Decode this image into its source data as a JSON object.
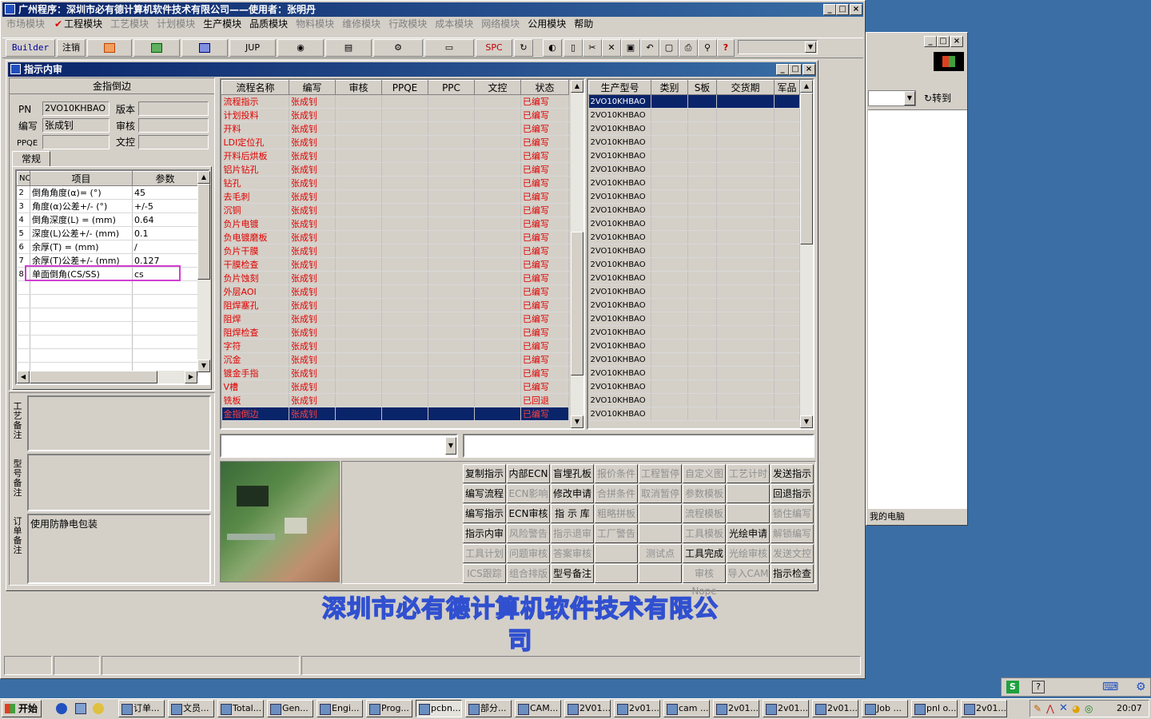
{
  "main_window": {
    "title": "广州程序：深圳市必有德计算机软件技术有限公司——使用者：张明丹"
  },
  "menu": [
    {
      "label": "市场模块",
      "active": false
    },
    {
      "label": "工程模块",
      "active": true,
      "check": "✔"
    },
    {
      "label": "工艺模块",
      "active": false
    },
    {
      "label": "计划模块",
      "active": false
    },
    {
      "label": "生产模块",
      "active": true
    },
    {
      "label": "品质模块",
      "active": true
    },
    {
      "label": "物料模块",
      "active": false
    },
    {
      "label": "维修模块",
      "active": false
    },
    {
      "label": "行政模块",
      "active": false
    },
    {
      "label": "成本模块",
      "active": false
    },
    {
      "label": "网络模块",
      "active": false
    },
    {
      "label": "公用模块",
      "active": true
    },
    {
      "label": "帮助",
      "active": true
    }
  ],
  "toolbar": {
    "builder": "Builder",
    "logout": "注销",
    "jup": "JUP",
    "spc": "SPC"
  },
  "child_window": {
    "title": "指示内审"
  },
  "left_panel": {
    "section_title": "金指倒边",
    "pn_label": "PN",
    "pn_value": "2VO10KHBAO",
    "version_label": "版本",
    "version_value": "",
    "author_label": "编写",
    "author_value": "张成钊",
    "review_label": "审核",
    "review_value": "",
    "ppqe_label": "PPQE",
    "ppqe_value": "",
    "doc_label": "文控",
    "doc_value": "",
    "tab": "常规",
    "param_headers": {
      "no": "NO",
      "item": "项目",
      "param": "参数"
    },
    "params": [
      {
        "no": "2",
        "item": "倒角角度(α)=  (°)",
        "value": "45"
      },
      {
        "no": "3",
        "item": "角度(α)公差+/-  (°)",
        "value": "+/-5"
      },
      {
        "no": "4",
        "item": "倒角深度(L) =  (mm)",
        "value": "0.64"
      },
      {
        "no": "5",
        "item": "深度(L)公差+/-  (mm)",
        "value": "0.1"
      },
      {
        "no": "6",
        "item": "余厚(T) =  (mm)",
        "value": "/"
      },
      {
        "no": "7",
        "item": "余厚(T)公差+/-  (mm)",
        "value": "0.127"
      },
      {
        "no": "8",
        "item": "单面倒角(CS/SS)",
        "value": "cs"
      }
    ],
    "notes": {
      "craft_label": "工艺备注",
      "model_label": "型号备注",
      "order_label": "订单备注",
      "craft": "",
      "model": "",
      "order": "使用防静电包装"
    }
  },
  "process_table": {
    "headers": [
      "流程名称",
      "编写",
      "审核",
      "PPQE",
      "PPC",
      "文控",
      "状态"
    ],
    "rows": [
      {
        "name": "流程指示",
        "author": "张成钊",
        "status": "已编写"
      },
      {
        "name": "计划投料",
        "author": "张成钊",
        "status": "已编写"
      },
      {
        "name": "开料",
        "author": "张成钊",
        "status": "已编写"
      },
      {
        "name": "LDI定位孔",
        "author": "张成钊",
        "status": "已编写"
      },
      {
        "name": "开料后烘板",
        "author": "张成钊",
        "status": "已编写"
      },
      {
        "name": "铝片钻孔",
        "author": "张成钊",
        "status": "已编写"
      },
      {
        "name": "钻孔",
        "author": "张成钊",
        "status": "已编写"
      },
      {
        "name": "去毛刺",
        "author": "张成钊",
        "status": "已编写"
      },
      {
        "name": "沉铜",
        "author": "张成钊",
        "status": "已编写"
      },
      {
        "name": "负片电镀",
        "author": "张成钊",
        "status": "已编写"
      },
      {
        "name": "负电镀磨板",
        "author": "张成钊",
        "status": "已编写"
      },
      {
        "name": "负片干膜",
        "author": "张成钊",
        "status": "已编写"
      },
      {
        "name": "干膜检查",
        "author": "张成钊",
        "status": "已编写"
      },
      {
        "name": "负片蚀刻",
        "author": "张成钊",
        "status": "已编写"
      },
      {
        "name": "外层AOI",
        "author": "张成钊",
        "status": "已编写"
      },
      {
        "name": "阻焊塞孔",
        "author": "张成钊",
        "status": "已编写"
      },
      {
        "name": "阻焊",
        "author": "张成钊",
        "status": "已编写"
      },
      {
        "name": "阻焊检查",
        "author": "张成钊",
        "status": "已编写"
      },
      {
        "name": "字符",
        "author": "张成钊",
        "status": "已编写"
      },
      {
        "name": "沉金",
        "author": "张成钊",
        "status": "已编写"
      },
      {
        "name": "镀金手指",
        "author": "张成钊",
        "status": "已编写"
      },
      {
        "name": "V槽",
        "author": "张成钊",
        "status": "已编写"
      },
      {
        "name": "铣板",
        "author": "张成钊",
        "status": "已回退"
      },
      {
        "name": "金指倒边",
        "author": "张成钊",
        "status": "已编写"
      }
    ],
    "selected": 23
  },
  "model_table": {
    "headers": [
      "生产型号",
      "类别",
      "S板",
      "交货期",
      "军品"
    ],
    "model": "2VO10KHBAO",
    "row_count": 24
  },
  "action_buttons": [
    [
      "复制指示",
      "内部ECN",
      "盲埋孔板",
      "报价条件",
      "工程暂停",
      "自定义图",
      "工艺计时",
      "发送指示"
    ],
    [
      "编写流程",
      "ECN影响",
      "修改申请",
      "合拼条件",
      "取消暂停",
      "参数模板",
      "",
      "回退指示"
    ],
    [
      "编写指示",
      "ECN审核",
      "指 示 库",
      "粗略拼板",
      "",
      "流程模板",
      "",
      "锁住编写"
    ],
    [
      "指示内审",
      "风险警告",
      "指示退审",
      "工厂警告",
      "",
      "工具模板",
      "光绘申请",
      "解锁编写"
    ],
    [
      "工具计划",
      "问题审核",
      "答案审核",
      "",
      "测试点",
      "工具完成",
      "光绘审核",
      "发送文控"
    ],
    [
      "ICS跟踪",
      "组合排版",
      "型号备注",
      "",
      "",
      "审核Nope",
      "导入CAM",
      "指示检查"
    ]
  ],
  "action_enabled": [
    [
      1,
      1,
      1,
      0,
      0,
      0,
      0,
      1
    ],
    [
      1,
      0,
      1,
      0,
      0,
      0,
      0,
      1
    ],
    [
      1,
      1,
      1,
      0,
      0,
      0,
      0,
      0
    ],
    [
      1,
      0,
      0,
      0,
      0,
      0,
      1,
      0
    ],
    [
      0,
      0,
      0,
      0,
      0,
      1,
      0,
      0
    ],
    [
      0,
      0,
      1,
      0,
      0,
      0,
      0,
      1
    ]
  ],
  "company_banner": "深圳市必有德计算机软件技术有限公司",
  "side_window": {
    "goto_label": "转到",
    "tree_item": "我的电脑"
  },
  "taskbar": {
    "start": "开始",
    "items": [
      "订单...",
      "文员...",
      "Total...",
      "Gen...",
      "Engi...",
      "Prog...",
      "pcbn...",
      "部分...",
      "CAM...",
      "2V01...",
      "2v01...",
      "cam ...",
      "2v01...",
      "2v01...",
      "2v01...",
      "Job ...",
      "pnl o...",
      "2v01..."
    ],
    "active_index": 6,
    "clock": "20:07"
  },
  "colors": {
    "desktop": "#3a6ea5",
    "face": "#d4d0c8",
    "title": "#0a246a",
    "red": "#e00000",
    "highlight_box": "#d040d0"
  }
}
